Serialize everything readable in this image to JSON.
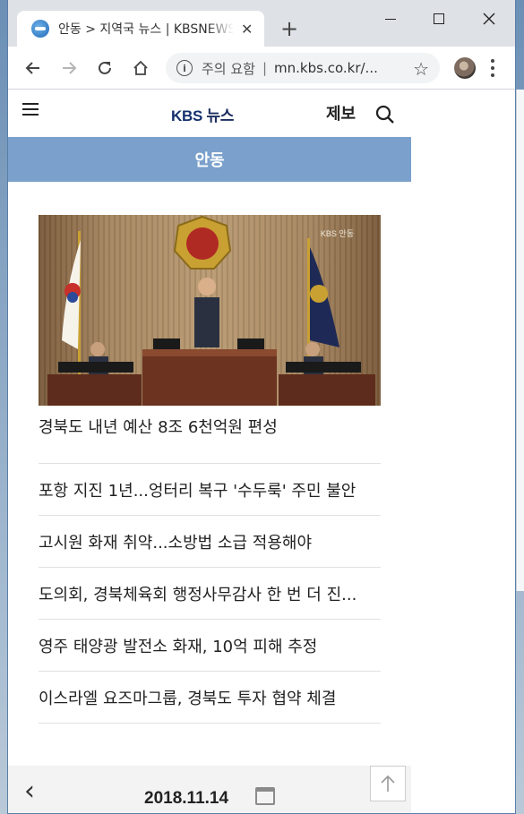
{
  "browser": {
    "tab_title": "안동 > 지역국 뉴스 | KBSNEWS",
    "tab_close": "✕",
    "new_tab": "+",
    "security_warning": "주의 요함",
    "separator": "|",
    "url": "mn.kbs.co.kr/...",
    "info_icon": "i"
  },
  "site": {
    "logo_kbs": "KBS",
    "logo_news": "뉴스",
    "tip_label": "제보",
    "region": "안동"
  },
  "hero": {
    "watermark": "KBS 안동",
    "caption": "경북도 내년 예산 8조 6천억원 편성"
  },
  "news_items": [
    "포항 지진 1년...엉터리 복구 '수두룩' 주민 불안",
    "고시원 화재 취약...소방법 소급 적용해야",
    "도의회, 경북체육회 행정사무감사 한 번 더 진...",
    "영주 태양광 발전소 화재, 10억 피해 추정",
    "이스라엘 요즈마그룹, 경북도 투자 협약 체결"
  ],
  "date_nav": {
    "date": "2018.11.14",
    "prev": "‹",
    "next": "›"
  },
  "icons": {
    "back": "back-arrow-icon",
    "forward": "forward-arrow-icon",
    "reload": "reload-icon",
    "home": "home-icon",
    "star": "star-icon",
    "search": "search-icon",
    "hamburger": "hamburger-menu-icon",
    "calendar": "calendar-icon",
    "top": "arrow-up-icon"
  },
  "colors": {
    "region_bar": "#7aa0cb",
    "logo": "#14306e"
  }
}
